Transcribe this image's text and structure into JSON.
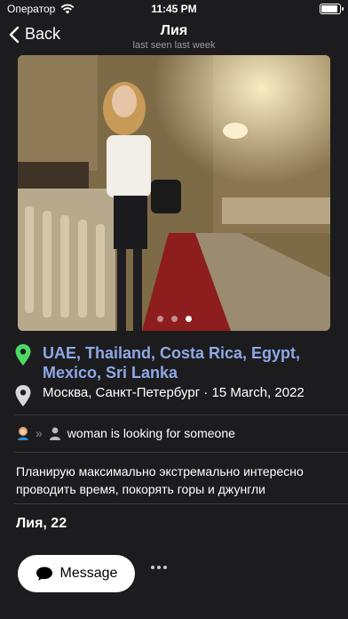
{
  "status_bar": {
    "carrier": "Оператор",
    "time": "11:45 PM"
  },
  "nav": {
    "back_label": "Back",
    "title": "Лия",
    "subtitle": "last seen last week"
  },
  "photo": {
    "page_count": 3,
    "active_page": 3
  },
  "location": {
    "countries": "UAE, Thailand, Costa Rica, Egypt, Mexico, Sri Lanka",
    "city_line": "Москва, Санкт-Петербург · 15 March, 2022"
  },
  "looking": {
    "separator": "»",
    "text": "woman is looking for someone"
  },
  "bio": "Планирую максимально экстремально интересно проводить время, покорять горы и джунгли",
  "name_age": "Лия, 22",
  "actions": {
    "message_label": "Message"
  },
  "colors": {
    "accent": "#8ea8e6",
    "pin_green": "#4cd964",
    "background": "#1c1c1e"
  }
}
